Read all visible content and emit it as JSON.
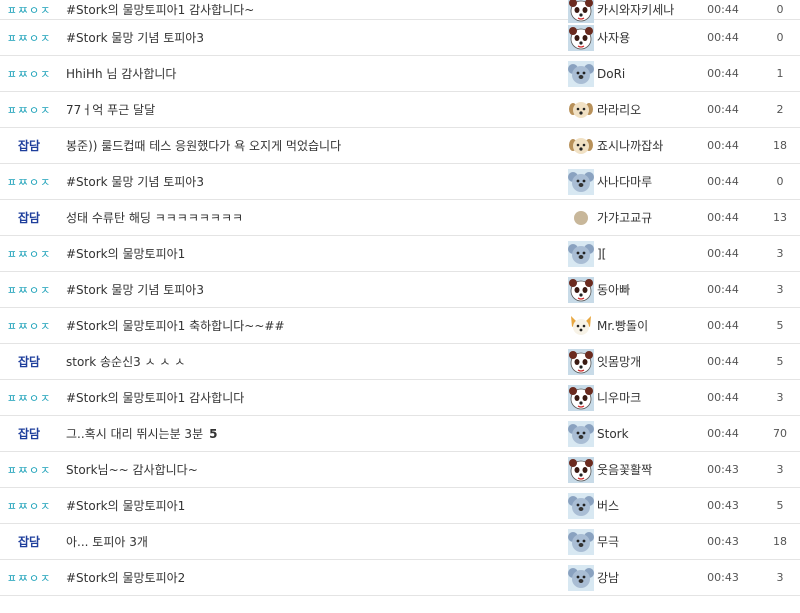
{
  "posts": [
    {
      "category": "ㅍㅉㅇㅈ",
      "title": "#Stork의 물망토피아1 감사합니다~",
      "comment": "",
      "author": "카시와자키세나",
      "time": "00:44",
      "views": "0",
      "avatar": "panda-avatar-icon"
    },
    {
      "category": "ㅍㅉㅇㅈ",
      "title": "#Stork 물망 기념 토피아3",
      "comment": "",
      "author": "사자용",
      "time": "00:44",
      "views": "0",
      "avatar": "panda-avatar-icon"
    },
    {
      "category": "ㅍㅉㅇㅈ",
      "title": "HhiHh 님 감사합니다",
      "comment": "",
      "author": "DoRi",
      "time": "00:44",
      "views": "1",
      "avatar": "koala-avatar-icon"
    },
    {
      "category": "ㅍㅉㅇㅈ",
      "title": "77ㅓ억 푸근 달달",
      "comment": "",
      "author": "라라리오",
      "time": "00:44",
      "views": "2",
      "avatar": "dog-avatar-icon"
    },
    {
      "category": "잡담",
      "title": "봉준)) 룰드컵때 테스 응원했다가 욕 오지게 먹었습니다",
      "comment": "",
      "author": "죠시나까잡솨",
      "time": "00:44",
      "views": "18",
      "avatar": "dog-avatar-icon"
    },
    {
      "category": "ㅍㅉㅇㅈ",
      "title": "#Stork 물망 기념 토피아3",
      "comment": "",
      "author": "사나다마루",
      "time": "00:44",
      "views": "0",
      "avatar": "koala-avatar-icon"
    },
    {
      "category": "잡담",
      "title": "성태 수류탄 해딩 ㅋㅋㅋㅋㅋㅋㅋㅋ",
      "comment": "",
      "author": "가갸고교규",
      "time": "00:44",
      "views": "13",
      "avatar": "circle-avatar-icon"
    },
    {
      "category": "ㅍㅉㅇㅈ",
      "title": "#Stork의 물망토피아1",
      "comment": "",
      "author": "][",
      "time": "00:44",
      "views": "3",
      "avatar": "koala-avatar-icon"
    },
    {
      "category": "ㅍㅉㅇㅈ",
      "title": "#Stork 물망 기념 토피아3",
      "comment": "",
      "author": "동아빠",
      "time": "00:44",
      "views": "3",
      "avatar": "panda-avatar-icon"
    },
    {
      "category": "ㅍㅉㅇㅈ",
      "title": "#Stork의 물망토피아1 축하합니다~~##",
      "comment": "",
      "author": "Mr.빵돌이",
      "time": "00:44",
      "views": "5",
      "avatar": "fox-avatar-icon"
    },
    {
      "category": "잡담",
      "title": "stork 송순신3 ㅅ ㅅ ㅅ",
      "comment": "",
      "author": "잇몸망개",
      "time": "00:44",
      "views": "5",
      "avatar": "panda-avatar-icon"
    },
    {
      "category": "ㅍㅉㅇㅈ",
      "title": "#Stork의 물망토피아1 감사합니다",
      "comment": "",
      "author": "니우마크",
      "time": "00:44",
      "views": "3",
      "avatar": "panda-avatar-icon"
    },
    {
      "category": "잡담",
      "title": "그..혹시 대리 뛰시는분 3분",
      "comment": "5",
      "author": "Stork",
      "time": "00:44",
      "views": "70",
      "avatar": "koala-avatar-icon"
    },
    {
      "category": "ㅍㅉㅇㅈ",
      "title": "Stork님~~ 감사합니다~",
      "comment": "",
      "author": "웃음꽃활짝",
      "time": "00:43",
      "views": "3",
      "avatar": "panda-avatar-icon"
    },
    {
      "category": "ㅍㅉㅇㅈ",
      "title": "#Stork의 물망토피아1",
      "comment": "",
      "author": "버스",
      "time": "00:43",
      "views": "5",
      "avatar": "koala-avatar-icon"
    },
    {
      "category": "잡담",
      "title": "아... 토피아 3개",
      "comment": "",
      "author": "무극",
      "time": "00:43",
      "views": "18",
      "avatar": "koala-avatar-icon"
    },
    {
      "category": "ㅍㅉㅇㅈ",
      "title": "#Stork의 물망토피아2",
      "comment": "",
      "author": "강남",
      "time": "00:43",
      "views": "3",
      "avatar": "koala-avatar-icon"
    }
  ],
  "colors": {
    "category_pjo": "#1aa0b8",
    "category_chat": "#1f3f9c",
    "row_border": "#e4e4e4"
  }
}
